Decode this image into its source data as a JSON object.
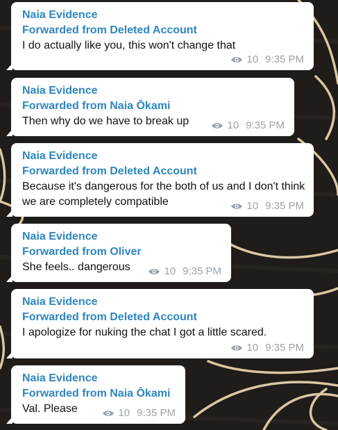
{
  "messages": [
    {
      "sender": "Naia Evidence",
      "forwarded": "Forwarded from Deleted Account",
      "text": "I do actually like you, this won't change that",
      "views": "10",
      "time": "9:35 PM"
    },
    {
      "sender": "Naia Evidence",
      "forwarded": "Forwarded from Naia Ōkami",
      "text": "Then why do we have to break up",
      "views": "10",
      "time": "9:35 PM"
    },
    {
      "sender": "Naia Evidence",
      "forwarded": "Forwarded from Deleted Account",
      "text": "Because it's dangerous for the both of us and I don't think we are completely compatible",
      "views": "10",
      "time": "9:35 PM"
    },
    {
      "sender": "Naia Evidence",
      "forwarded": "Forwarded from Oliver",
      "text": "She feels.. dangerous",
      "views": "10",
      "time": "9:35 PM"
    },
    {
      "sender": "Naia Evidence",
      "forwarded": "Forwarded from Deleted Account",
      "text": "I apologize for nuking the chat I got a little scared.",
      "views": "10",
      "time": "9:35 PM"
    },
    {
      "sender": "Naia Evidence",
      "forwarded": "Forwarded from Naia Ōkami",
      "text": "Val. Please",
      "views": "10",
      "time": "9:35 PM"
    }
  ],
  "icons": {
    "views": "eye-icon"
  },
  "colors": {
    "accent": "#2e86c1",
    "bubble": "#ffffff",
    "meta": "#9aa3ab",
    "background": "#1e1b18"
  }
}
